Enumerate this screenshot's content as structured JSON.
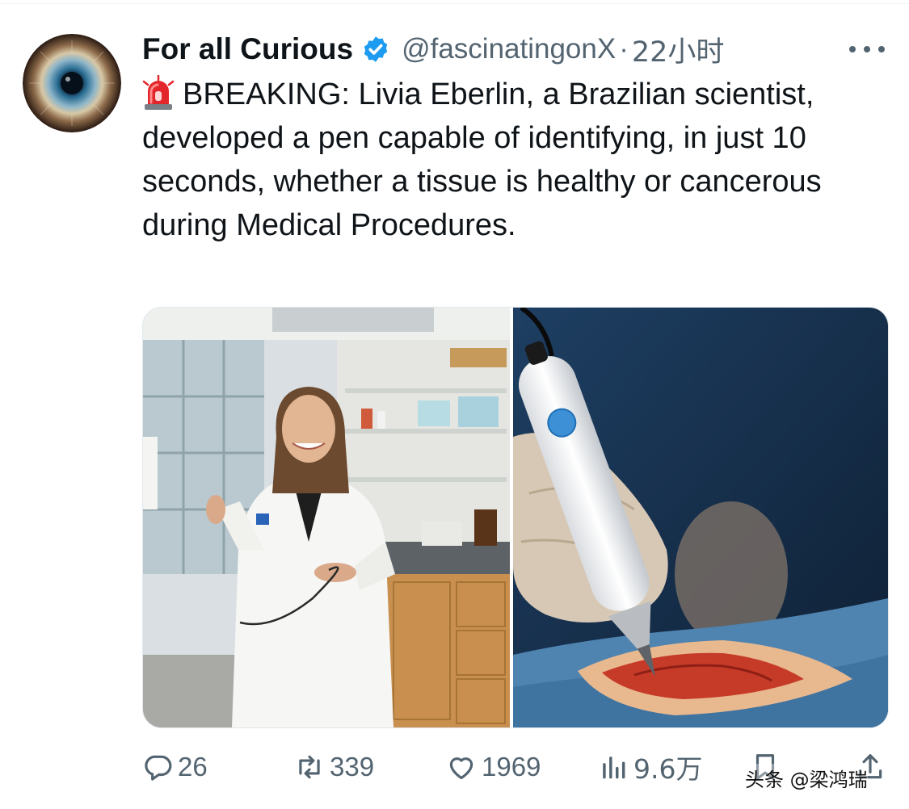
{
  "tweet": {
    "author": {
      "display_name": "For all Curious",
      "handle": "@fascinatingonX",
      "separator": "·",
      "time": "22小时",
      "verified": true,
      "avatar": "eye-iris-avatar"
    },
    "more_icon": "ellipsis-icon",
    "emoji": "rotating-light-siren",
    "text": "BREAKING: Livia Eberlin, a Brazilian scientist, developed a pen capable of identifying, in just 10 seconds, whether a tissue is healthy or cancerous during Medical Procedures.",
    "media": [
      {
        "subject": "scientist-in-lab-coat-photo"
      },
      {
        "subject": "handheld-pen-device-on-tissue-photo"
      }
    ],
    "actions": {
      "reply": {
        "icon": "reply-icon",
        "count": "26"
      },
      "retweet": {
        "icon": "retweet-icon",
        "count": "339"
      },
      "like": {
        "icon": "heart-icon",
        "count": "1969"
      },
      "views": {
        "icon": "views-bar-chart-icon",
        "count": "9.6万"
      },
      "bookmark": {
        "icon": "bookmark-icon"
      },
      "share": {
        "icon": "share-icon"
      }
    }
  },
  "watermark": "头条 @梁鸿瑞",
  "colors": {
    "text_primary": "#0f1419",
    "text_secondary": "#536471",
    "verified_blue": "#1d9bf0"
  }
}
